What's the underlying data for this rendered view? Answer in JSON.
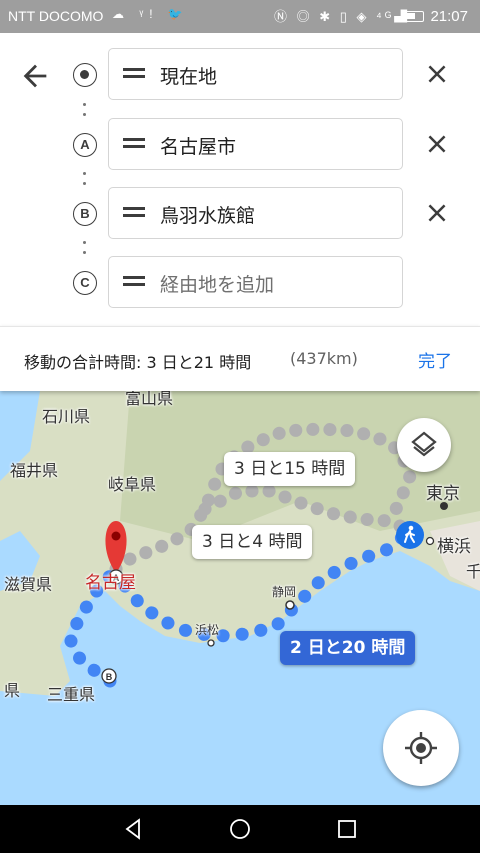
{
  "status_bar": {
    "carrier": "NTT DOCOMO",
    "left_icons": "☁ ᵞ! 🐦",
    "right_icons": "Ⓝ ◎ ✱ ▯ ◈ ⁴ᴳ▟",
    "time": "21:07",
    "icons": [
      "cloud-icon",
      "yahoo-icon",
      "twitter-icon",
      "nfc-icon",
      "location-icon",
      "bluetooth-icon",
      "vibrate-icon",
      "wifi-icon",
      "signal-icon",
      "battery-icon"
    ]
  },
  "route": {
    "stops": [
      {
        "marker": "",
        "label": "現在地",
        "type": "origin"
      },
      {
        "marker": "A",
        "label": "名古屋市",
        "type": "stop"
      },
      {
        "marker": "B",
        "label": "鳥羽水族館",
        "type": "stop"
      },
      {
        "marker": "C",
        "label": "経由地を追加",
        "type": "placeholder"
      }
    ],
    "summary": "移動の合計時間: 3 日と21 時間",
    "distance": "(437km)",
    "done_label": "完了"
  },
  "map": {
    "labels": {
      "ishikawa": "石川県",
      "fukui": "福井県",
      "gifu": "岐阜県",
      "shiga": "滋賀県",
      "mie": "三重県",
      "mie_left": "県",
      "nagoya": "名古屋",
      "tokyo": "東京",
      "yokohama": "横浜",
      "shizuoka": "静岡",
      "hamamatsu": "浜松",
      "chiba_partial": "千",
      "top_partial": "富山県"
    },
    "route_bubbles": {
      "north": "3 日と15 時間",
      "middle": "3 日と4 時間",
      "selected": "2 日と20 時間"
    },
    "colors": {
      "selected_route": "#4285f4",
      "alternate_route": "#b0b0b0",
      "land": "#d9dfc4",
      "water": "#aadaff"
    }
  }
}
